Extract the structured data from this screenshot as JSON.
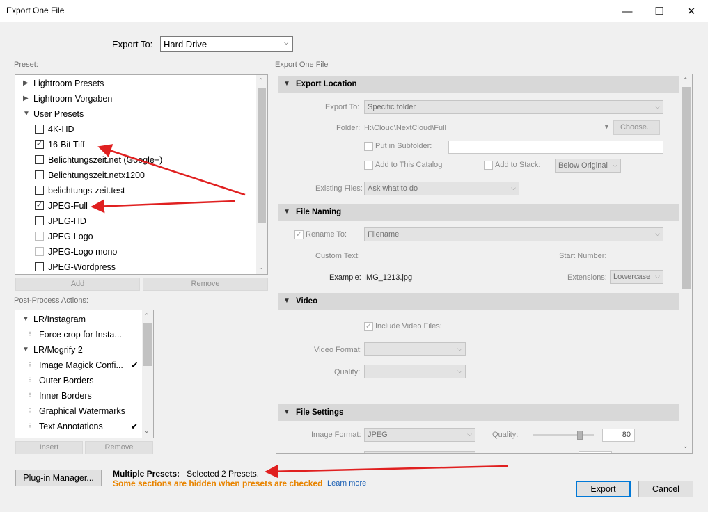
{
  "window": {
    "title": "Export One File",
    "minimize": "—",
    "maximize": "☐",
    "close": "✕"
  },
  "export_to": {
    "label": "Export To:",
    "value": "Hard Drive"
  },
  "preset": {
    "label": "Preset:",
    "items": [
      {
        "label": "Lightroom Presets",
        "kind": "folder",
        "expanded": false
      },
      {
        "label": "Lightroom-Vorgaben",
        "kind": "folder",
        "expanded": false
      },
      {
        "label": "User Presets",
        "kind": "folder",
        "expanded": true
      },
      {
        "label": "4K-HD",
        "checked": false
      },
      {
        "label": "16-Bit Tiff",
        "checked": true
      },
      {
        "label": "Belichtungszeit.net (Google+)",
        "checked": false
      },
      {
        "label": "Belichtungszeit.netx1200",
        "checked": false
      },
      {
        "label": "belichtungs-zeit.test",
        "checked": false
      },
      {
        "label": "JPEG-Full",
        "checked": true
      },
      {
        "label": "JPEG-HD",
        "checked": false
      },
      {
        "label": "JPEG-Logo",
        "checked": false
      },
      {
        "label": "JPEG-Logo mono",
        "checked": false
      },
      {
        "label": "JPEG-Wordpress",
        "checked": false
      }
    ],
    "add": "Add",
    "remove": "Remove"
  },
  "post_process": {
    "label": "Post-Process Actions:",
    "items": [
      {
        "label": "LR/Instagram",
        "level": 0,
        "check": ""
      },
      {
        "label": "Force crop for Insta...",
        "level": 1,
        "check": ""
      },
      {
        "label": "LR/Mogrify 2",
        "level": 0,
        "check": ""
      },
      {
        "label": "Image Magick Confi...",
        "level": 1,
        "check": "✔"
      },
      {
        "label": "Outer Borders",
        "level": 1,
        "check": ""
      },
      {
        "label": "Inner Borders",
        "level": 1,
        "check": ""
      },
      {
        "label": "Graphical Watermarks",
        "level": 1,
        "check": ""
      },
      {
        "label": "Text Annotations",
        "level": 1,
        "check": "✔"
      }
    ],
    "insert": "Insert",
    "remove": "Remove"
  },
  "panel": {
    "title": "Export One File",
    "export_location": {
      "header": "Export Location",
      "export_to_label": "Export To:",
      "export_to_value": "Specific folder",
      "folder_label": "Folder:",
      "folder_value": "H:\\Cloud\\NextCloud\\Full",
      "choose": "Choose...",
      "put_in_subfolder": "Put in Subfolder:",
      "add_to_catalog": "Add to This Catalog",
      "add_to_stack": "Add to Stack:",
      "stack_value": "Below Original",
      "existing_files_label": "Existing Files:",
      "existing_files_value": "Ask what to do"
    },
    "file_naming": {
      "header": "File Naming",
      "rename_to": "Rename To:",
      "rename_value": "Filename",
      "custom_text": "Custom Text:",
      "start_number": "Start Number:",
      "example_label": "Example:",
      "example_value": "IMG_1213.jpg",
      "extensions_label": "Extensions:",
      "extensions_value": "Lowercase"
    },
    "video": {
      "header": "Video",
      "include_video": "Include Video Files:",
      "video_format": "Video Format:",
      "quality": "Quality:"
    },
    "file_settings": {
      "header": "File Settings",
      "image_format_label": "Image Format:",
      "image_format_value": "JPEG",
      "quality_label": "Quality:",
      "quality_value": "80",
      "quality_fraction": 0.8
    }
  },
  "bottom": {
    "plugin_manager": "Plug-in Manager...",
    "multiple_presets_label": "Multiple Presets:",
    "multiple_presets_value": "Selected 2 Presets.",
    "hidden_notice": "Some sections are hidden when presets are checked",
    "learn_more": "Learn more",
    "export": "Export",
    "cancel": "Cancel"
  },
  "colors": {
    "arrow": "#e02020",
    "notice": "#e88400",
    "link": "#1a5fb4",
    "accent": "#0078d7"
  }
}
